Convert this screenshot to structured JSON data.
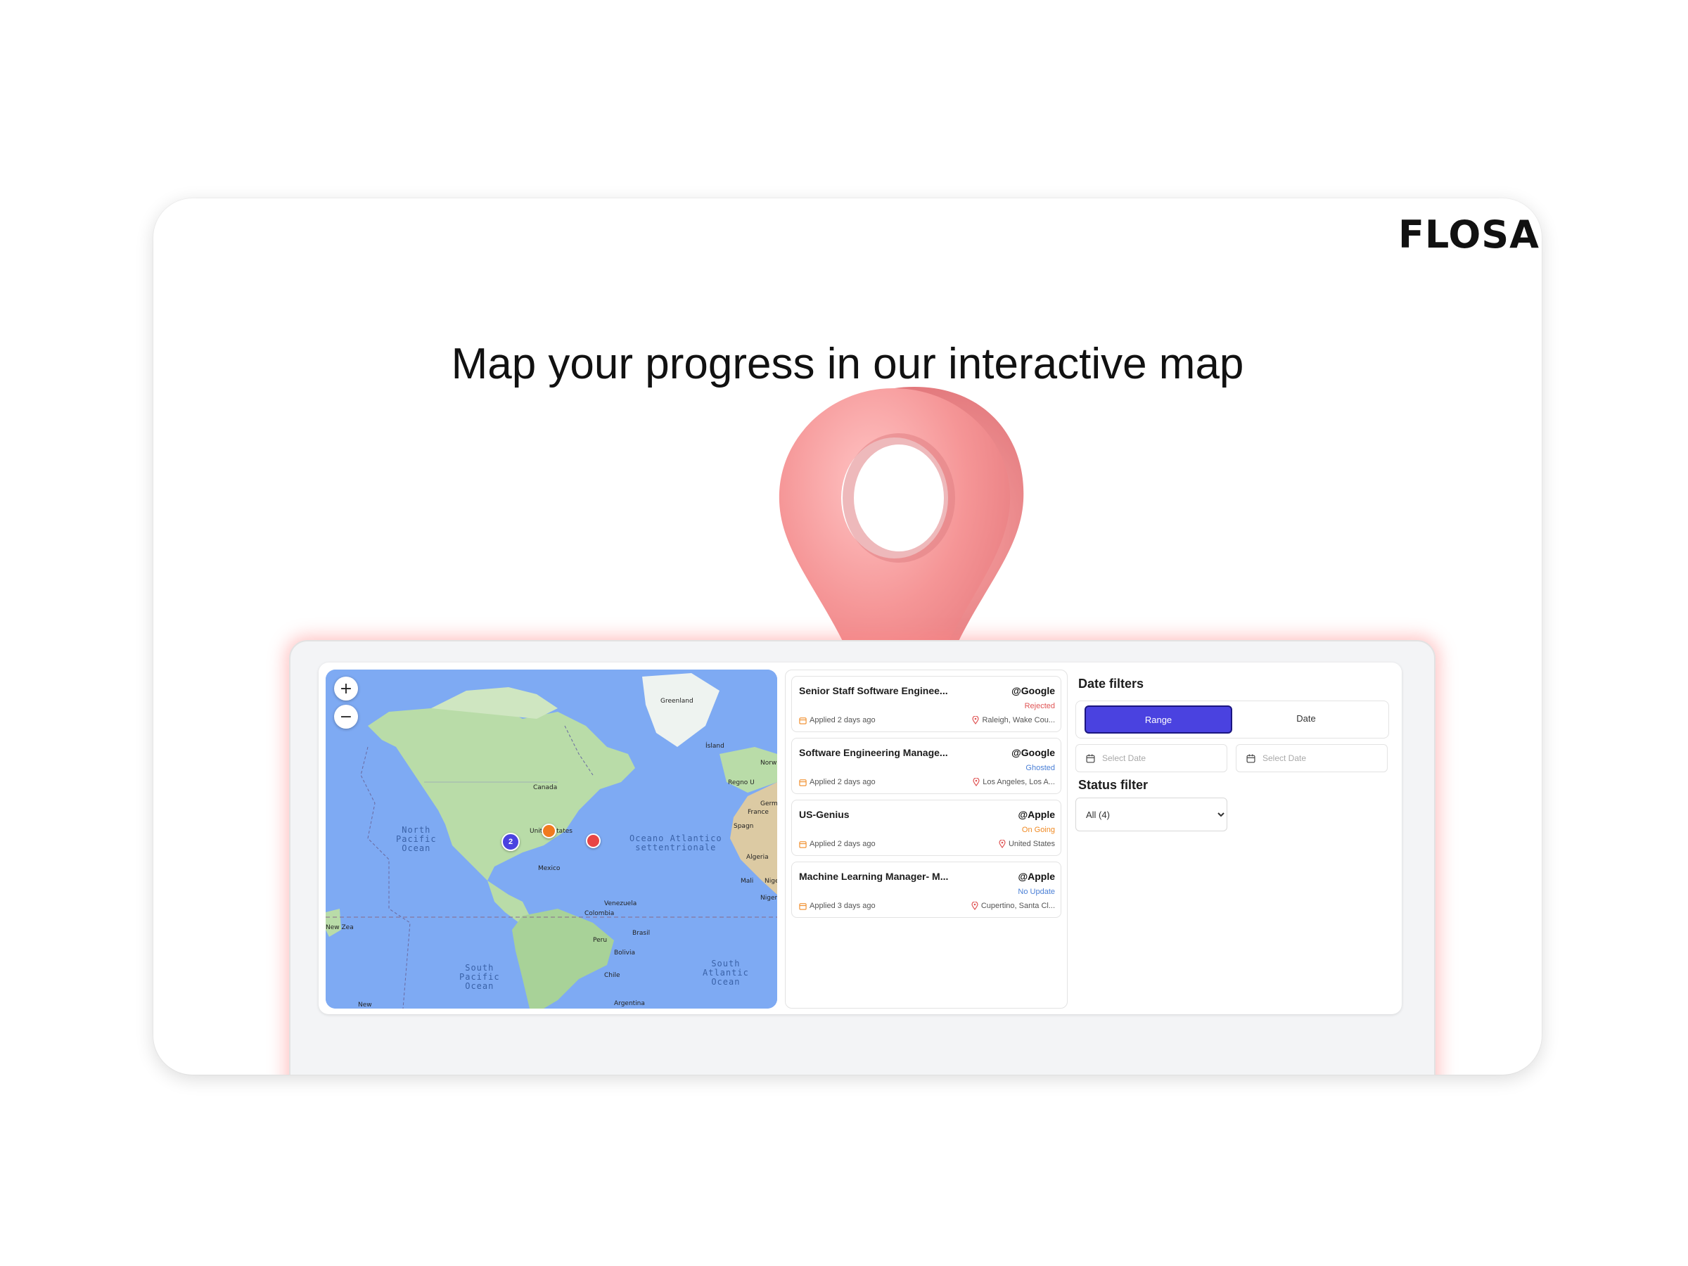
{
  "brand": {
    "logo": "FLOSA"
  },
  "hero": {
    "headline": "Map your progress in our interactive map"
  },
  "map": {
    "zoom_in": "+",
    "zoom_out": "−",
    "labels": {
      "greenland": "Greenland",
      "islanda": "Ísland",
      "canada": "Canada",
      "united_states": "United States",
      "mexico": "Mexico",
      "venezuela": "Venezuela",
      "colombia": "Colombia",
      "peru": "Peru",
      "brasil": "Brasil",
      "bolivia": "Bolivia",
      "chile": "Chile",
      "argentina": "Argentina",
      "algeria": "Algeria",
      "mali": "Mali",
      "niger": "Nige",
      "nigeria": "Nigeri",
      "espana": "Spagn",
      "france": "France",
      "regno_unito": "Regno U",
      "norway": "Norw",
      "germany": "Germ",
      "new_zealand_a": "New Zea",
      "new_zealand_b": "New"
    },
    "oceans": {
      "north_pacific": "North\nPacific\nOcean",
      "south_pacific": "South\nPacific\nOcean",
      "north_atlantic": "Oceano Atlantico\nsettentrionale",
      "south_atlantic": "South\nAtlantic\nOcean"
    },
    "cluster_count": "2",
    "colors": {
      "cluster": "#4a42e0",
      "ongoing": "#f07a1f",
      "rejected": "#e84545",
      "water": "#7eaaf3",
      "land": "#b9dca8"
    }
  },
  "jobs": [
    {
      "title": "Senior Staff Software Enginee...",
      "company": "@Google",
      "status": "Rejected",
      "status_color": "#e05555",
      "applied": "Applied 2 days ago",
      "location": "Raleigh, Wake Cou..."
    },
    {
      "title": "Software Engineering Manage...",
      "company": "@Google",
      "status": "Ghosted",
      "status_color": "#4a7fd6",
      "applied": "Applied 2 days ago",
      "location": "Los Angeles, Los A..."
    },
    {
      "title": "US-Genius",
      "company": "@Apple",
      "status": "On Going",
      "status_color": "#f08a24",
      "applied": "Applied 2 days ago",
      "location": "United States"
    },
    {
      "title": "Machine Learning Manager- M...",
      "company": "@Apple",
      "status": "No Update",
      "status_color": "#4a7fd6",
      "applied": "Applied 3 days ago",
      "location": "Cupertino, Santa Cl..."
    }
  ],
  "filters": {
    "date_title": "Date filters",
    "range_label": "Range",
    "date_label": "Date",
    "start_placeholder": "Select Date",
    "end_placeholder": "Select Date",
    "status_title": "Status filter",
    "status_selected": "All (4)"
  }
}
